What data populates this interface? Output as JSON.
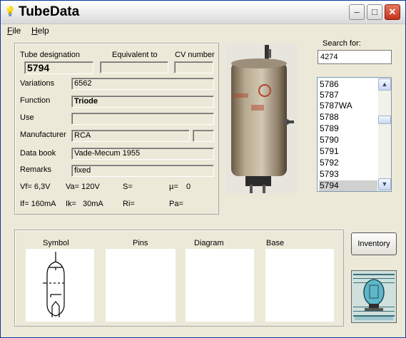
{
  "window": {
    "title": "TubeData",
    "controls": {
      "minimize": "–",
      "maximize": "□",
      "close": "✕"
    }
  },
  "menu": {
    "file": "File",
    "file_key": "F",
    "file_rest": "ile",
    "help": "Help",
    "help_key": "H",
    "help_rest": "elp"
  },
  "tube": {
    "designation_label": "Tube designation",
    "equivalent_label": "Equivalent to",
    "cv_label": "CV number",
    "designation": "5794",
    "equivalent": "",
    "cv": "",
    "variations_label": "Variations",
    "variations": "6562",
    "function_label": "Function",
    "function": "Triode",
    "use_label": "Use",
    "use": "",
    "manufacturer_label": "Manufacturer",
    "manufacturer": "RCA",
    "manufacturer_extra": "",
    "databook_label": "Data book",
    "databook": "Vade-Mecum 1955",
    "remarks_label": "Remarks",
    "remarks": "fixed"
  },
  "params": {
    "vf": "Vf= 6,3V",
    "va": "Va= 120V",
    "s": "S=",
    "mu": "µ=",
    "mu_val": "0",
    "if": "If= 160mA",
    "ik": "Ik=",
    "ik_val": "30mA",
    "ri": "Ri=",
    "pa": "Pa="
  },
  "search": {
    "label": "Search for:",
    "value": "4274"
  },
  "list": {
    "items": [
      "5786",
      "5787",
      "5787WA",
      "5788",
      "5789",
      "5790",
      "5791",
      "5792",
      "5793",
      "5794"
    ],
    "selected": "5794"
  },
  "panels": {
    "symbol": "Symbol",
    "pins": "Pins",
    "diagram": "Diagram",
    "base": "Base"
  },
  "buttons": {
    "inventory": "Inventory"
  },
  "colors": {
    "selection": "#d0d0d0",
    "close_red": "#c3331a",
    "window_bg": "#ece9d8"
  },
  "icons": {
    "app": "lightbulb-icon",
    "scroll_up": "▲",
    "scroll_down": "▼"
  }
}
